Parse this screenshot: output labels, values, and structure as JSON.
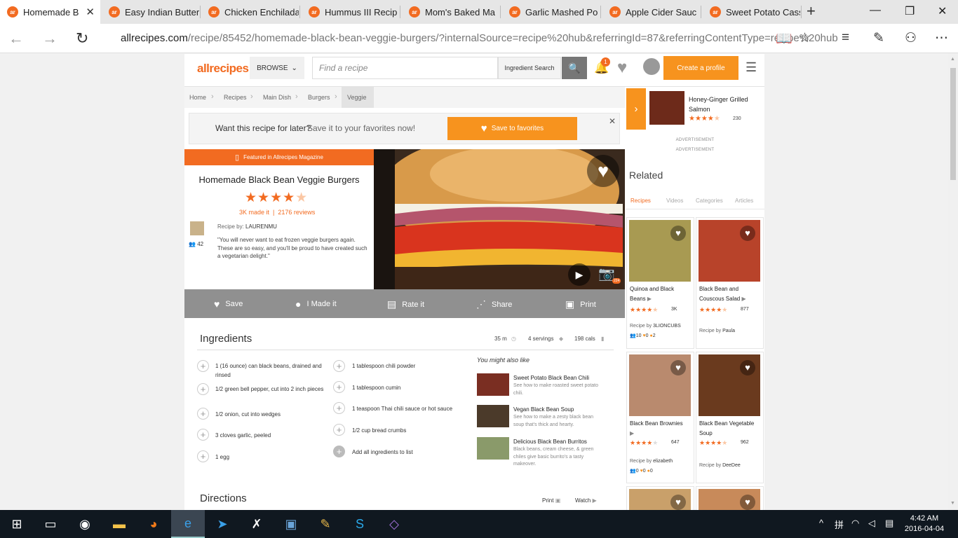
{
  "browser": {
    "tabs": [
      {
        "label": "Homemade B",
        "active": true
      },
      {
        "label": "Easy Indian Butter"
      },
      {
        "label": "Chicken Enchilada"
      },
      {
        "label": "Hummus III Recip"
      },
      {
        "label": "Mom's Baked Ma"
      },
      {
        "label": "Garlic Mashed Po"
      },
      {
        "label": "Apple Cider Sauc"
      },
      {
        "label": "Sweet Potato Cass"
      }
    ],
    "favicon_text": "ar",
    "new_tab": "+",
    "url_domain": "allrecipes.com",
    "url_path": "/recipe/85452/homemade-black-bean-veggie-burgers/?internalSource=recipe%20hub&referringId=87&referringContentType=recipe%20hub"
  },
  "site_header": {
    "logo": "allrecipes",
    "browse": "BROWSE",
    "search_placeholder": "Find a recipe",
    "ingredient_search": "Ingredient Search",
    "notification_count": "1",
    "create_profile": "Create a profile"
  },
  "breadcrumbs": [
    "Home",
    "Recipes",
    "Main Dish",
    "Burgers",
    "Veggie"
  ],
  "save_prompt": {
    "question": "Want this recipe for later?",
    "subtext": "Save it to your favorites now!",
    "button": "Save to favorites"
  },
  "recipe": {
    "featured": "Featured in Allrecipes Magazine",
    "title": "Homemade Black Bean Veggie Burgers",
    "rating": 4.5,
    "made_it": "3K made it",
    "reviews": "2176 reviews",
    "recipe_by_label": "Recipe by:",
    "author": "LAURENMU",
    "followers": "42",
    "quote": "\"You will never want to eat frozen veggie burgers again. These are so easy, and you'll be proud to have created such a vegetarian delight.\"",
    "photo_count": "224"
  },
  "actions": {
    "save": "Save",
    "made": "I Made it",
    "rate": "Rate it",
    "share": "Share",
    "print": "Print"
  },
  "ingredients": {
    "heading": "Ingredients",
    "time": "35 m",
    "servings": "4 servings",
    "calories": "198 cals",
    "left_column": [
      "1 (16 ounce) can black beans, drained and rinsed",
      "1/2 green bell pepper, cut into 2 inch pieces",
      "1/2 onion, cut into wedges",
      "3 cloves garlic, peeled",
      "1 egg"
    ],
    "right_column": [
      "1 tablespoon chili powder",
      "1 tablespoon cumin",
      "1 teaspoon Thai chili sauce or hot sauce",
      "1/2 cup bread crumbs"
    ],
    "add_all": "Add all ingredients to list"
  },
  "also_like": {
    "heading": "You might also like",
    "items": [
      {
        "title": "Sweet Potato Black Bean Chili",
        "desc": "See how to make roasted sweet potato chili."
      },
      {
        "title": "Vegan Black Bean Soup",
        "desc": "See how to make a zesty black bean soup that's thick and hearty."
      },
      {
        "title": "Delicious Black Bean Burritos",
        "desc": "Black beans, cream cheese, & green chiles give basic burrito's a tasty makeover."
      }
    ]
  },
  "directions": {
    "heading": "Directions",
    "print": "Print",
    "watch": "Watch"
  },
  "sidebar": {
    "featured": {
      "title": "Honey-Ginger Grilled Salmon",
      "count": "230"
    },
    "advertisement": "ADVERTISEMENT",
    "related_heading": "Related",
    "tabs": [
      "Recipes",
      "Videos",
      "Categories",
      "Articles"
    ],
    "cards": [
      {
        "title": "Quinoa and Black Beans",
        "count": "3K",
        "by_label": "Recipe by",
        "by": "3LIONCUBS",
        "stats": [
          "10",
          "0",
          "2"
        ]
      },
      {
        "title": "Black Bean and Couscous Salad",
        "count": "877",
        "by_label": "Recipe by",
        "by": "Paula"
      },
      {
        "title": "Black Bean Brownies",
        "count": "647",
        "by_label": "Recipe by",
        "by": "elizabeth",
        "stats": [
          "0",
          "0",
          "0"
        ]
      },
      {
        "title": "Black Bean Vegetable Soup",
        "count": "962",
        "by_label": "Recipe by",
        "by": "DeeDee"
      }
    ]
  },
  "taskbar": {
    "time": "4:42 AM",
    "date": "2016-04-04"
  },
  "colors": {
    "brand_orange": "#f26b21",
    "button_orange": "#f7931e",
    "action_bar_gray": "#909090",
    "taskbar": "#101820"
  }
}
